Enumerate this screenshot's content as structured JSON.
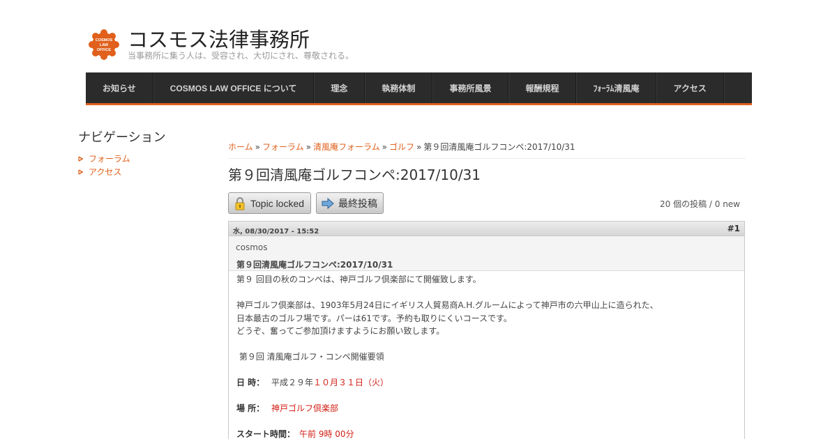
{
  "site": {
    "name": "コスモス法律事務所",
    "slogan": "当事務所に集う人は、受容され、大切にされ、尊敬される。",
    "logo_text": "COSMOS LAW OFFICE",
    "accent": "#e0601c"
  },
  "menu": [
    {
      "label": "お知らせ"
    },
    {
      "label": "COSMOS LAW OFFICE について"
    },
    {
      "label": "理念"
    },
    {
      "label": "執務体制"
    },
    {
      "label": "事務所風景"
    },
    {
      "label": "報酬規程"
    },
    {
      "label": "ﾌｫｰﾗﾑ清風庵"
    },
    {
      "label": "アクセス"
    }
  ],
  "sidebar": {
    "title": "ナビゲーション",
    "items": [
      {
        "label": "フォーラム"
      },
      {
        "label": "アクセス"
      }
    ]
  },
  "breadcrumb": {
    "items": [
      "ホーム",
      "フォーラム",
      "清風庵フォーラム",
      "ゴルフ"
    ],
    "current": "第９回清風庵ゴルフコンペ:2017/10/31",
    "separator": "»"
  },
  "page_title": "第９回清風庵ゴルフコンペ:2017/10/31",
  "actions": {
    "locked_label": "Topic locked",
    "last_post_label": "最終投稿",
    "post_count": "20 個の投稿 / 0 new"
  },
  "post": {
    "date": "水, 08/30/2017 - 15:52",
    "number": "#1",
    "author": "cosmos",
    "subject": "第９回清風庵ゴルフコンペ:2017/10/31",
    "body": {
      "line1": "第９ 回目の秋のコンペは、神戸ゴルフ倶楽部にて開催致します。",
      "line2": "神戸ゴルフ倶楽部は、1903年5月24日にイギリス人貿易商A.H.グルームによって神戸市の六甲山上に造られた、",
      "line3": "日本最古のゴルフ場です。パーは61です。予約も取りにくいコースです。",
      "line4": "どうぞ、奮ってご参加頂けますようにお願い致します。",
      "line5": " 第９回 清風庵ゴルフ・コンペ開催要領",
      "date_label": "日 時：",
      "date_prefix": "平成２９年",
      "date_value": "１０月３１日（火）",
      "place_label": "場 所：",
      "place_value": "神戸ゴルフ倶楽部",
      "start_label": "スタート時間：",
      "start_value": "午前 9時 00分"
    }
  }
}
